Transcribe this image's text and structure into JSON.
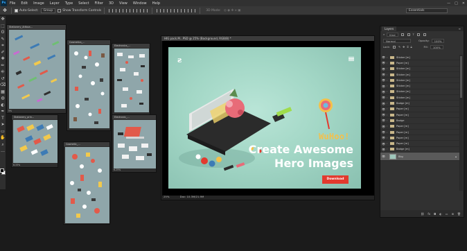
{
  "menubar": {
    "logo": "Ps",
    "items": [
      "File",
      "Edit",
      "Image",
      "Layer",
      "Type",
      "Select",
      "Filter",
      "3D",
      "View",
      "Window",
      "Help"
    ],
    "window_controls": [
      "—",
      "□",
      "✕"
    ]
  },
  "options": {
    "auto_select_label": "Auto-Select:",
    "auto_select_value": "Group",
    "show_transform_label": "Show Transform Controls",
    "mode_3d_label": "3D Mode:",
    "workspace": "Essentials"
  },
  "toolbox": {
    "tools": [
      "move",
      "marquee",
      "lasso",
      "quick-select",
      "crop",
      "eyedropper",
      "healing",
      "brush",
      "stamp",
      "history-brush",
      "eraser",
      "gradient",
      "blur",
      "dodge",
      "pen",
      "type",
      "path-select",
      "shape",
      "hand",
      "zoom",
      "more"
    ],
    "glyphs": [
      "✥",
      "⬚",
      "ʘ",
      "✎",
      "⌗",
      "✐",
      "✚",
      "✏",
      "⎆",
      "↺",
      "⌫",
      "▦",
      "◍",
      "◐",
      "✒",
      "T",
      "➤",
      "▭",
      "✋",
      "⌕",
      "…"
    ]
  },
  "docs": [
    {
      "title": "Stationery_Artboa...",
      "zoom": "5%"
    },
    {
      "title": "Cosmetics_...",
      "zoom": ""
    },
    {
      "title": "Electronics_...",
      "zoom": ""
    },
    {
      "title": "Stationery_prin...",
      "zoom": "8.33%"
    },
    {
      "title": "Cosmetic_...",
      "zoom": "8.33%"
    },
    {
      "title": "Electronic_...",
      "zoom": "6.25%"
    }
  ],
  "maindoc": {
    "title": "HIG pack.M...PSD @ 25% (Background, RGB/8) *",
    "zoom": "25%",
    "doc_size": "Doc: 10.3M/21.9M",
    "hero": {
      "brand_tag": "WuHoo!",
      "headline_line1": "Create Awesome",
      "headline_line2": "Hero Images",
      "button_label": "Download",
      "accent_color": "#e23a2e",
      "tag_color": "#f4c04a"
    }
  },
  "layers": {
    "tab": "Layers",
    "filter_kind": "Kind",
    "blend_mode": "Normal",
    "opacity_label": "Opacity:",
    "opacity": "100%",
    "lock_label": "Lock:",
    "fill_label": "Fill:",
    "fill": "100%",
    "items": [
      "Sticker [m]",
      "Paper [m]",
      "Sticker [m]",
      "Sticker [m]",
      "Sticker [m]",
      "Sticker [m]",
      "Sticker [m]",
      "Sticker [m]",
      "Badge [m]",
      "Paper [m]",
      "Paper [m]",
      "Badge",
      "Paper [m]",
      "Paper [m]",
      "Paper [m]",
      "Paper [m]",
      "Badge [m]"
    ],
    "background_layer": "Bkg",
    "footer_icons": [
      "link-icon",
      "fx-icon",
      "mask-icon",
      "adjustment-icon",
      "group-icon",
      "new-layer-icon",
      "trash-icon"
    ]
  }
}
